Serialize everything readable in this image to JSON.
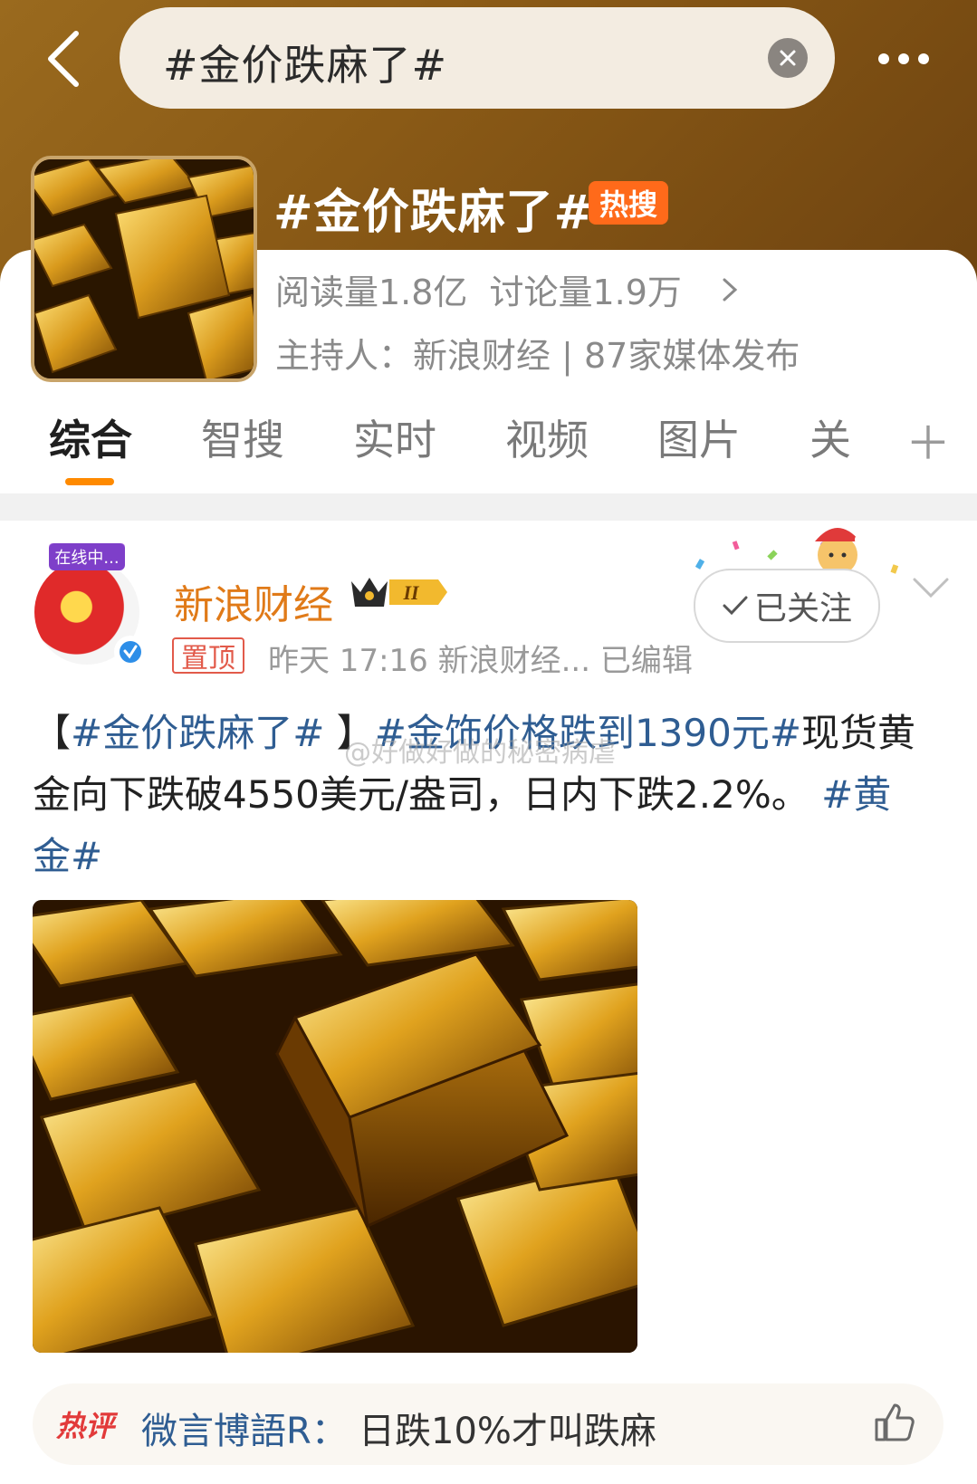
{
  "search": {
    "query": "#金价跌麻了#"
  },
  "topic": {
    "title": "#金价跌麻了#",
    "hot_badge": "热搜",
    "reads": "阅读量1.8亿",
    "discussions": "讨论量1.9万",
    "host": "主持人：新浪财经 | 87家媒体发布"
  },
  "tabs": [
    {
      "label": "综合",
      "active": true
    },
    {
      "label": "智搜"
    },
    {
      "label": "实时"
    },
    {
      "label": "视频"
    },
    {
      "label": "图片"
    },
    {
      "label": "关"
    }
  ],
  "post": {
    "live_badge": "在线中...",
    "author": "新浪财经",
    "level_badge": "II",
    "pinned": "置顶",
    "meta": "昨天 17:16   新浪财经...   已编辑",
    "follow": "已关注",
    "body": {
      "open_bracket": "【",
      "tag1": "#金价跌麻了#",
      "close_bracket": " 】",
      "tag2": "#金饰价格跌到1390元#",
      "text": "现货黄金向下跌破4550美元/盎司，日内下跌2.2%。 ",
      "tag3": "#黄金#"
    },
    "watermark": "@好做好做的秘密病虐"
  },
  "hot_comment": {
    "tag": "热评",
    "author": "微言博語R",
    "separator": "：",
    "text": "日跌10%才叫跌麻"
  },
  "colors": {
    "header": "#8a5a16",
    "accent": "#ff8a00",
    "hashtag": "#2f5d92",
    "author": "#e07a18"
  }
}
